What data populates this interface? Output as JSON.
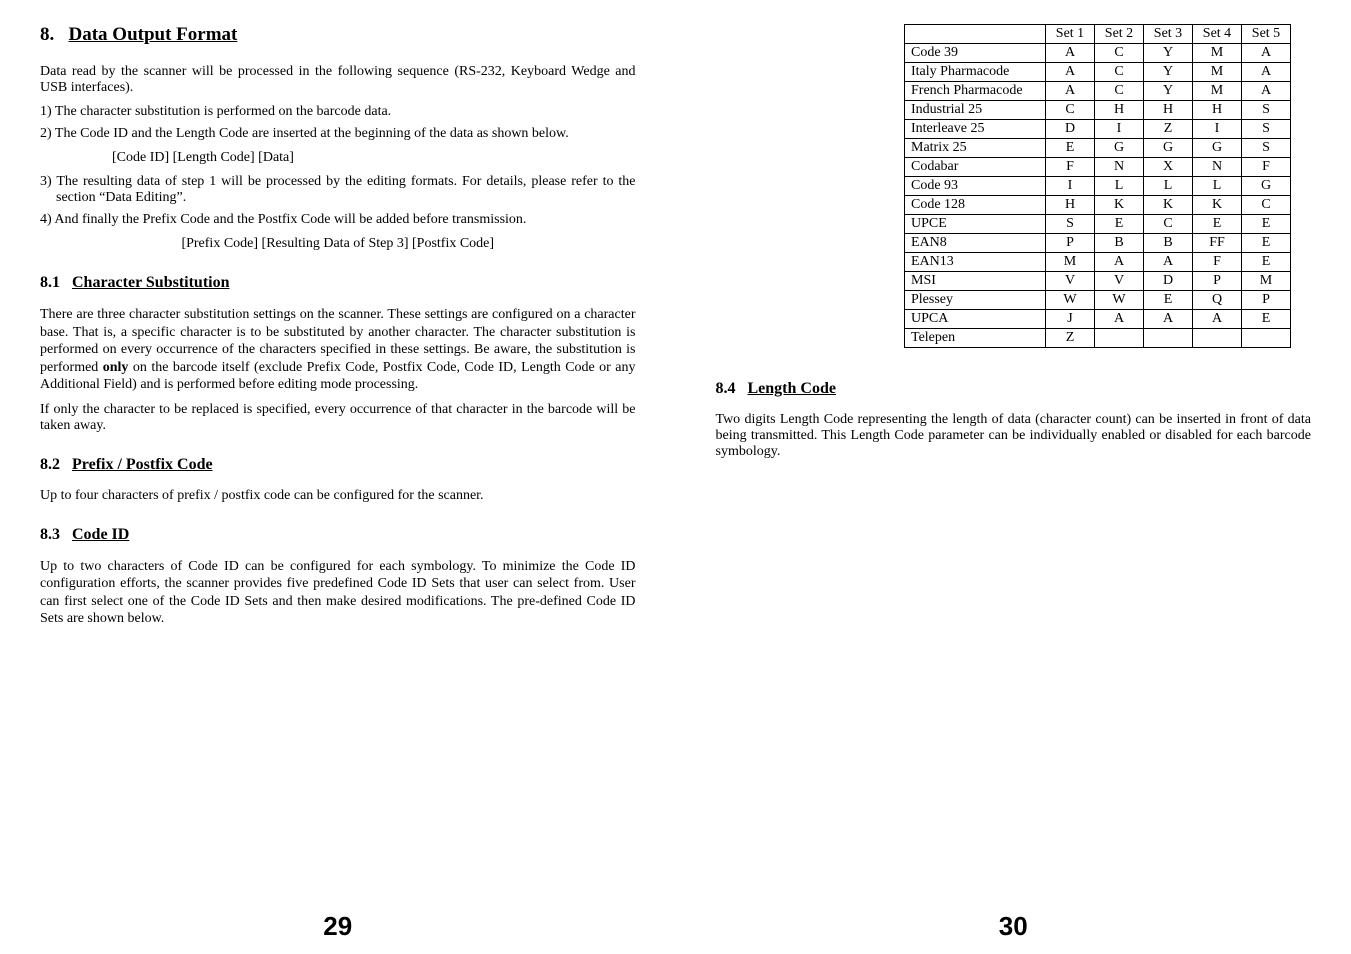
{
  "left": {
    "heading": {
      "num": "8.",
      "text": "Data Output Format"
    },
    "intro": "Data read by the scanner will be processed in the following sequence (RS-232, Keyboard Wedge and USB interfaces).",
    "step1": "1) The character substitution is performed on the barcode data.",
    "step2": "2) The Code ID and the Length Code are inserted at the beginning of the data as shown below.",
    "step2_line": "[Code ID]  [Length Code]  [Data]",
    "step3": "3) The resulting data of step 1 will be processed by the editing formats. For details, please refer to the section “Data Editing”.",
    "step4": "4) And finally the Prefix Code and the Postfix Code will be added before transmission.",
    "step4_line": "[Prefix Code] [Resulting Data of Step 3] [Postfix Code]",
    "s81": {
      "num": "8.1",
      "text": "Character Substitution"
    },
    "s81_p1a": "There are three character substitution settings on the scanner. These settings are configured on a character base. That is, a specific character is to be substituted by another character. The character substitution is performed on every occurrence of the characters specified in these settings. Be aware, the substitution is performed ",
    "s81_p1_only": "only",
    "s81_p1b": " on the barcode itself (exclude Prefix Code, Postfix Code, Code ID, Length Code or any Additional Field) and is performed before editing mode processing.",
    "s81_p2": "If only the character to be replaced is specified, every occurrence of that character in the barcode will be taken away.",
    "s82": {
      "num": "8.2",
      "text": "Prefix / Postfix Code"
    },
    "s82_p": "Up to four characters of prefix / postfix code can be configured for the scanner.",
    "s83": {
      "num": "8.3",
      "text": "Code ID"
    },
    "s83_p": "Up to two characters of Code ID can be configured for each symbology. To minimize the Code ID configuration efforts, the scanner provides five predefined Code ID Sets that user can select from. User can first select one of the Code ID Sets and then make desired modifications. The pre-defined Code ID Sets are shown below.",
    "page_number": "29"
  },
  "right": {
    "table": {
      "headers": [
        "",
        "Set 1",
        "Set 2",
        "Set 3",
        "Set 4",
        "Set 5"
      ],
      "rows": [
        [
          "Code 39",
          "A",
          "C",
          "Y",
          "M",
          "A"
        ],
        [
          "Italy Pharmacode",
          "A",
          "C",
          "Y",
          "M",
          "A"
        ],
        [
          "French Pharmacode",
          "A",
          "C",
          "Y",
          "M",
          "A"
        ],
        [
          "Industrial 25",
          "C",
          "H",
          "H",
          "H",
          "S"
        ],
        [
          "Interleave 25",
          "D",
          "I",
          "Z",
          "I",
          "S"
        ],
        [
          "Matrix 25",
          "E",
          "G",
          "G",
          "G",
          "S"
        ],
        [
          "Codabar",
          "F",
          "N",
          "X",
          "N",
          "F"
        ],
        [
          "Code 93",
          "I",
          "L",
          "L",
          "L",
          "G"
        ],
        [
          "Code 128",
          "H",
          "K",
          "K",
          "K",
          "C"
        ],
        [
          "UPCE",
          "S",
          "E",
          "C",
          "E",
          "E"
        ],
        [
          "EAN8",
          "P",
          "B",
          "B",
          "FF",
          "E"
        ],
        [
          "EAN13",
          "M",
          "A",
          "A",
          "F",
          "E"
        ],
        [
          "MSI",
          "V",
          "V",
          "D",
          "P",
          "M"
        ],
        [
          "Plessey",
          "W",
          "W",
          "E",
          "Q",
          "P"
        ],
        [
          "UPCA",
          "J",
          "A",
          "A",
          "A",
          "E"
        ],
        [
          "Telepen",
          "Z",
          "",
          "",
          "",
          ""
        ]
      ]
    },
    "s84": {
      "num": "8.4",
      "text": "Length Code"
    },
    "s84_p": "Two digits Length Code representing the length of data (character count) can be inserted in front of data being transmitted. This Length Code parameter can be individually enabled or disabled for each barcode symbology.",
    "page_number": "30"
  }
}
